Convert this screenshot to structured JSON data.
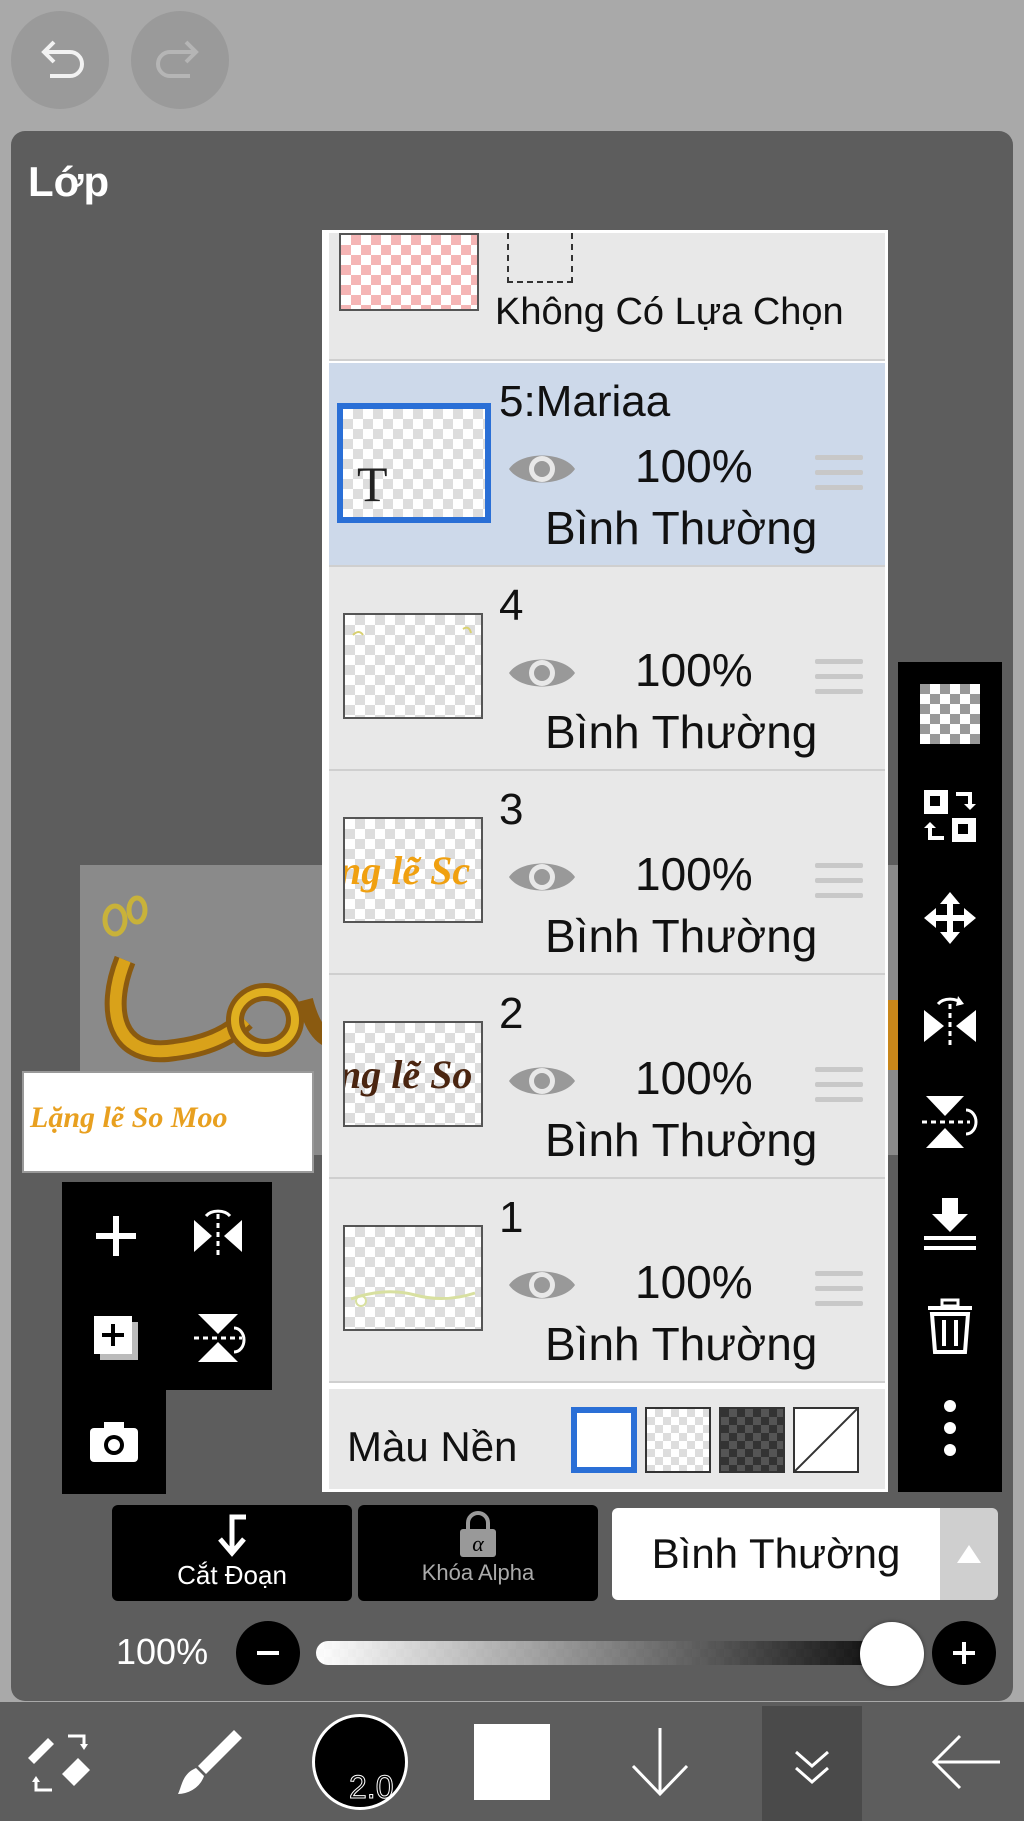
{
  "panel": {
    "title": "Lớp"
  },
  "selection_row": {
    "label": "Không Có Lựa Chọn"
  },
  "layers": [
    {
      "name": "5:Mariaa",
      "opacity": "100%",
      "blend": "Bình Thường",
      "selected": true,
      "thumb_text": "T"
    },
    {
      "name": "4",
      "opacity": "100%",
      "blend": "Bình Thường",
      "selected": false
    },
    {
      "name": "3",
      "opacity": "100%",
      "blend": "Bình Thường",
      "selected": false,
      "thumb_text": "ng lẽ Sc"
    },
    {
      "name": "2",
      "opacity": "100%",
      "blend": "Bình Thường",
      "selected": false,
      "thumb_text": "ng lẽ So"
    },
    {
      "name": "1",
      "opacity": "100%",
      "blend": "Bình Thường",
      "selected": false
    }
  ],
  "background": {
    "label": "Màu Nền",
    "options": [
      "white",
      "transparent",
      "dark-checker",
      "none"
    ],
    "selected": "white"
  },
  "actions": {
    "clipping_label": "Cắt Đoạn",
    "alpha_lock_label": "Khóa Alpha",
    "blend_mode": "Bình Thường"
  },
  "opacity": {
    "label": "100%",
    "value": 1.0
  },
  "bottombar": {
    "brush_size": "2.0"
  },
  "canvas": {
    "nav_text": "Lặng lẽ So Moo"
  },
  "colors": {
    "accent": "#2a6fd6",
    "selected_row": "#cdd9ea",
    "panel": "#5d5d5d"
  }
}
